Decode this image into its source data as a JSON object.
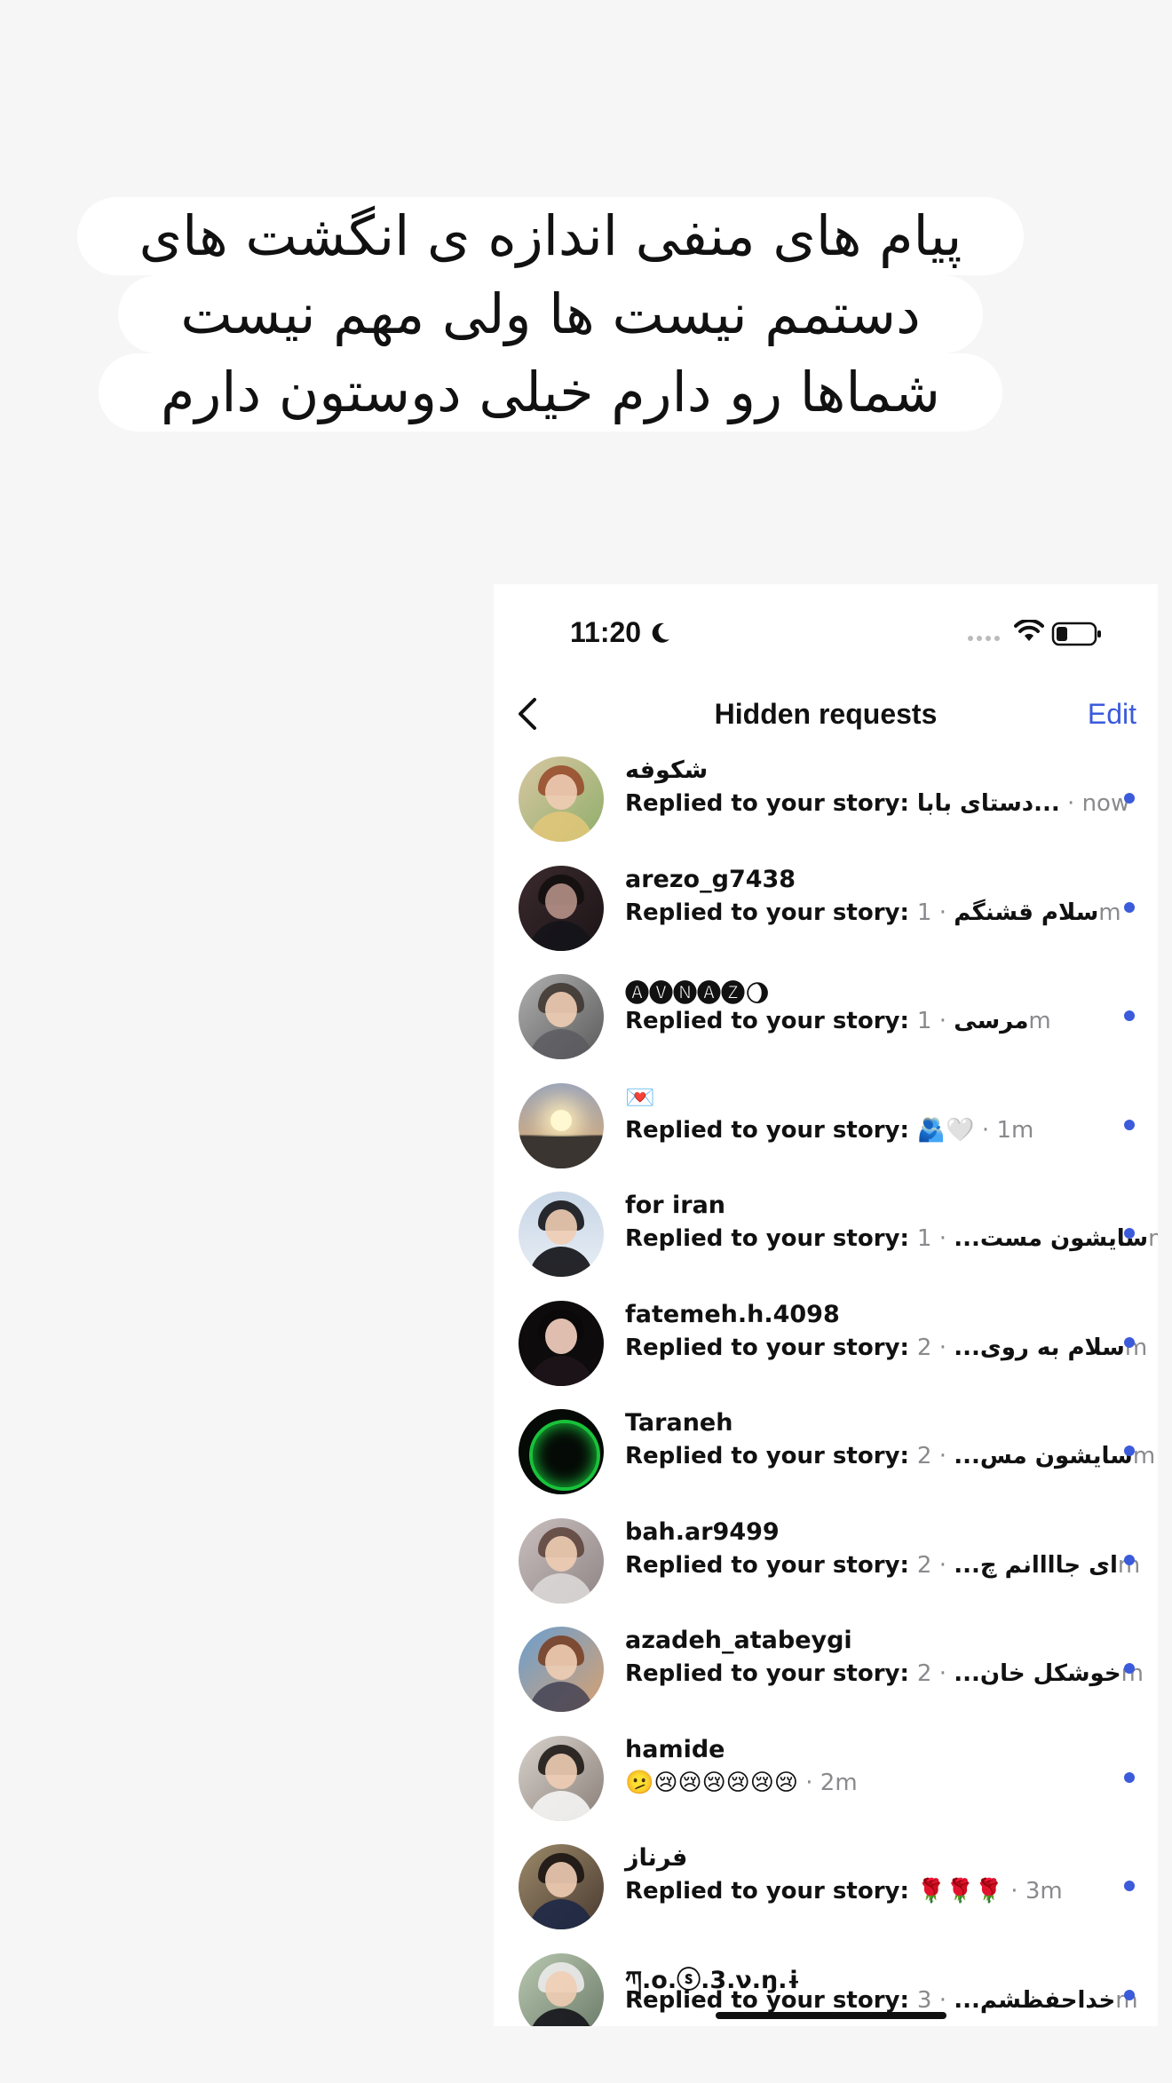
{
  "caption": {
    "lines": [
      "پیام های منفی اندازه ی انگشت های",
      "دستمم نیست ها ولی مهم نیست",
      "شماها رو دارم خیلی دوستون دارم"
    ]
  },
  "status_bar": {
    "time": "11:20",
    "icons": [
      "moon-icon",
      "signal-dots-icon",
      "wifi-icon",
      "battery-icon"
    ]
  },
  "nav": {
    "title": "Hidden requests",
    "edit_label": "Edit",
    "back_icon": "chevron-left-icon"
  },
  "colors": {
    "accent": "#3b5bdb",
    "unread_dot": "#3b5bdb",
    "muted": "#8a8a8e"
  },
  "requests": [
    {
      "name": "شکوفه",
      "prefix": "Replied to your story: ",
      "snippet": "دستای بابا...",
      "time": " · now"
    },
    {
      "name": "arezo_g7438",
      "prefix": "Replied to your story: ",
      "snippet": "سلام قشنگم",
      "time": " · 1m"
    },
    {
      "name": "🅐🅥🅝🅐🅩🌖",
      "prefix": "Replied to your story: ",
      "snippet": "مرسی",
      "time": " · 1m"
    },
    {
      "name": "💌",
      "prefix": "Replied to your story: ",
      "snippet": "🫂🤍",
      "time": " · 1m"
    },
    {
      "name": "for iran",
      "prefix": "Replied to your story: ",
      "snippet": "سایشون مست...",
      "time": " · 1m"
    },
    {
      "name": "fatemeh.h.4098",
      "prefix": "Replied to your story: ",
      "snippet": "سلام به روی...",
      "time": " · 2m"
    },
    {
      "name": "Taraneh",
      "prefix": "Replied to your story: ",
      "snippet": "سایشون مس...",
      "time": " · 2m"
    },
    {
      "name": "bah.ar9499",
      "prefix": "Replied to your story: ",
      "snippet": "ای جاااانم چ...",
      "time": " · 2m"
    },
    {
      "name": "azadeh_atabeygi",
      "prefix": "Replied to your story: ",
      "snippet": "خوشکل خان...",
      "time": " · 2m"
    },
    {
      "name": "hamide",
      "prefix": "",
      "snippet": "🫤😢😢😢😢😢😢",
      "time": " · 2m"
    },
    {
      "name": "فرناز",
      "prefix": "Replied to your story: ",
      "snippet": "🌹🌹🌹",
      "time": " · 3m"
    },
    {
      "name": "ཀ.o.ⓢ.3.ν.ŋ.ɨ",
      "prefix": "Replied to your story: ",
      "snippet": "خداحفظشم...",
      "time": " · 3m"
    }
  ]
}
